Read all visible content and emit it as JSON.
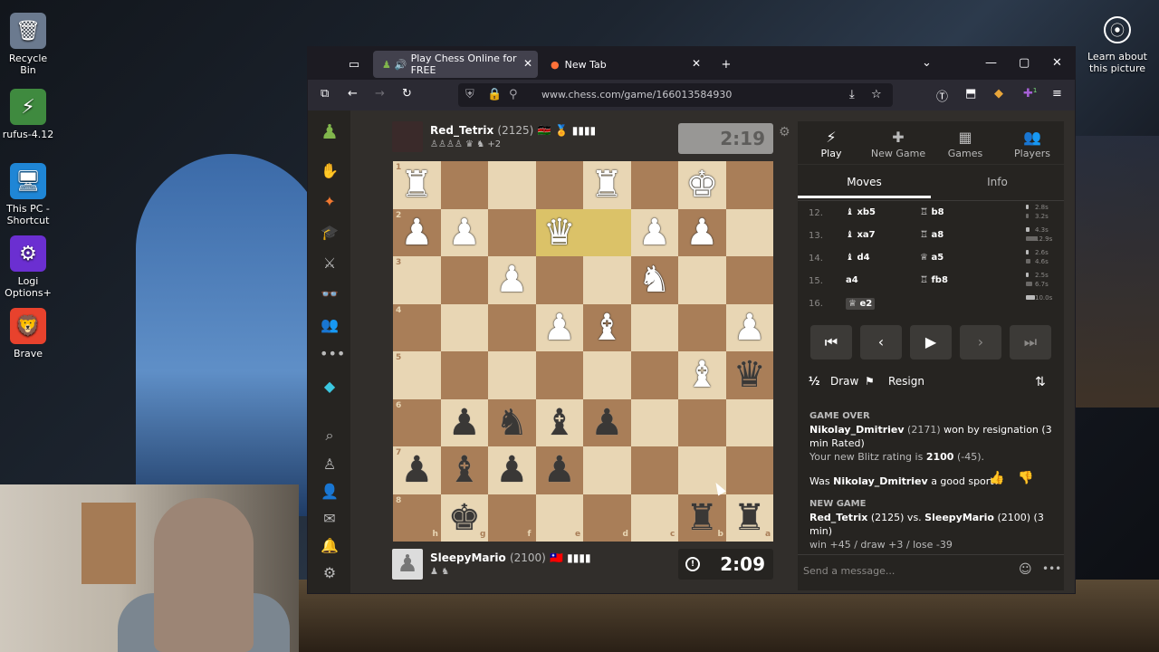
{
  "desktop": {
    "icons": [
      {
        "label": "Recycle Bin",
        "glyph": "🗑",
        "bg": "#6b7a8f"
      },
      {
        "label": "rufus-4.12",
        "glyph": "⚡",
        "bg": "#3f8a3f"
      },
      {
        "label": "This PC - Shortcut",
        "glyph": "🖥",
        "bg": "#1f86d6"
      },
      {
        "label": "Logi Options+",
        "glyph": "⚙",
        "bg": "#6b2fd1"
      },
      {
        "label": "Brave",
        "glyph": "🦁",
        "bg": "#e8422d"
      }
    ],
    "learn": {
      "glyph": "⦿",
      "label": "Learn about this picture"
    }
  },
  "browser": {
    "tabs": [
      {
        "label": "Play Chess Online for FREE",
        "icon": "chess-pawn-icon",
        "active": true
      },
      {
        "label": "New Tab",
        "icon": "firefox-icon",
        "active": false
      }
    ],
    "url": "www.chess.com/game/166013584930",
    "ext_badge": "1"
  },
  "game": {
    "top_player": {
      "name": "Red_Tetrix",
      "rating": "(2125)",
      "flags": "🇰🇪 🏅 ▮▮▮▮",
      "captured": "♙♙♙♙ ♛ ♞ +2",
      "clock": "2:19"
    },
    "bottom_player": {
      "name": "SleepyMario",
      "rating": "(2100)",
      "flags": "🇹🇼 ▮▮▮▮",
      "captured": "♟ ♞",
      "clock": "2:09"
    },
    "ranks": [
      "1",
      "2",
      "3",
      "4",
      "5",
      "6",
      "7",
      "8"
    ],
    "files": [
      "h",
      "g",
      "f",
      "e",
      "d",
      "c",
      "b",
      "a"
    ],
    "pieces": [
      {
        "sq": "h1",
        "g": "♜",
        "c": "w"
      },
      {
        "sq": "d1",
        "g": "♜",
        "c": "w"
      },
      {
        "sq": "b1",
        "g": "♚",
        "c": "w"
      },
      {
        "sq": "h2",
        "g": "♟",
        "c": "w"
      },
      {
        "sq": "g2",
        "g": "♟",
        "c": "w"
      },
      {
        "sq": "e2",
        "g": "♛",
        "c": "w"
      },
      {
        "sq": "c2",
        "g": "♟",
        "c": "w"
      },
      {
        "sq": "b2",
        "g": "♟",
        "c": "w"
      },
      {
        "sq": "f3",
        "g": "♟",
        "c": "w"
      },
      {
        "sq": "c3",
        "g": "♞",
        "c": "w"
      },
      {
        "sq": "e4",
        "g": "♟",
        "c": "w"
      },
      {
        "sq": "d4",
        "g": "♝",
        "c": "w"
      },
      {
        "sq": "a4",
        "g": "♟",
        "c": "w"
      },
      {
        "sq": "b5",
        "g": "♝",
        "c": "w"
      },
      {
        "sq": "a5",
        "g": "♛",
        "c": "b"
      },
      {
        "sq": "g6",
        "g": "♟",
        "c": "b"
      },
      {
        "sq": "f6",
        "g": "♞",
        "c": "b"
      },
      {
        "sq": "e6",
        "g": "♝",
        "c": "b"
      },
      {
        "sq": "d6",
        "g": "♟",
        "c": "b"
      },
      {
        "sq": "h7",
        "g": "♟",
        "c": "b"
      },
      {
        "sq": "g7",
        "g": "♝",
        "c": "b"
      },
      {
        "sq": "f7",
        "g": "♟",
        "c": "b"
      },
      {
        "sq": "e7",
        "g": "♟",
        "c": "b"
      },
      {
        "sq": "g8",
        "g": "♚",
        "c": "b"
      },
      {
        "sq": "b8",
        "g": "♜",
        "c": "b"
      },
      {
        "sq": "a8",
        "g": "♜",
        "c": "b"
      }
    ],
    "highlight": [
      "e2",
      "d2"
    ],
    "colors": {
      "light": "#e8d6b4",
      "dark": "#a97e58",
      "highlight": "#dbc268"
    }
  },
  "panel": {
    "nav": [
      {
        "icon": "⚡",
        "label": "Play"
      },
      {
        "icon": "✚",
        "label": "New Game"
      },
      {
        "icon": "▦",
        "label": "Games"
      },
      {
        "icon": "👥",
        "label": "Players"
      }
    ],
    "tabs": [
      "Moves",
      "Info"
    ],
    "moves": [
      {
        "n": "12.",
        "w": "♝ xb5",
        "b": "♖ b8",
        "tw": "2.8s",
        "tb": "3.2s",
        "bw": 0.28,
        "bb": 0.32
      },
      {
        "n": "13.",
        "w": "♝ xa7",
        "b": "♖ a8",
        "tw": "4.3s",
        "tb": "12.9s",
        "bw": 0.43,
        "bb": 1.29
      },
      {
        "n": "14.",
        "w": "♝ d4",
        "b": "♕ a5",
        "tw": "2.6s",
        "tb": "4.6s",
        "bw": 0.26,
        "bb": 0.46
      },
      {
        "n": "15.",
        "w": "a4",
        "b": "♖ fb8",
        "tw": "2.5s",
        "tb": "6.7s",
        "bw": 0.25,
        "bb": 0.67
      },
      {
        "n": "16.",
        "w": "♕ e2",
        "b": "",
        "tw": "10.0s",
        "tb": "",
        "bw": 1.0,
        "bb": 0
      }
    ],
    "controls": [
      "⏮",
      "‹",
      "▶",
      "›",
      "⏭"
    ],
    "draw": "Draw",
    "resign": "Resign",
    "draw_icon": "½",
    "game_over": {
      "heading": "GAME OVER",
      "winner": "Nikolay_Dmitriev",
      "winner_rating": "(2171)",
      "result_text": "won by resignation (3 min Rated)",
      "rating_line_pre": "Your new Blitz rating is",
      "rating_value": "2100",
      "rating_delta": "(-45).",
      "sport_pre": "Was",
      "sport_name": "Nikolay_Dmitriev",
      "sport_post": "a good sport?"
    },
    "new_game": {
      "heading": "NEW GAME",
      "p1": "Red_Tetrix",
      "p1r": "(2125) vs.",
      "p2": "SleepyMario",
      "p2r": "(2100) (3 min)",
      "odds": "win +45 / draw +3 / lose -39"
    },
    "chat_placeholder": "Send a message..."
  }
}
